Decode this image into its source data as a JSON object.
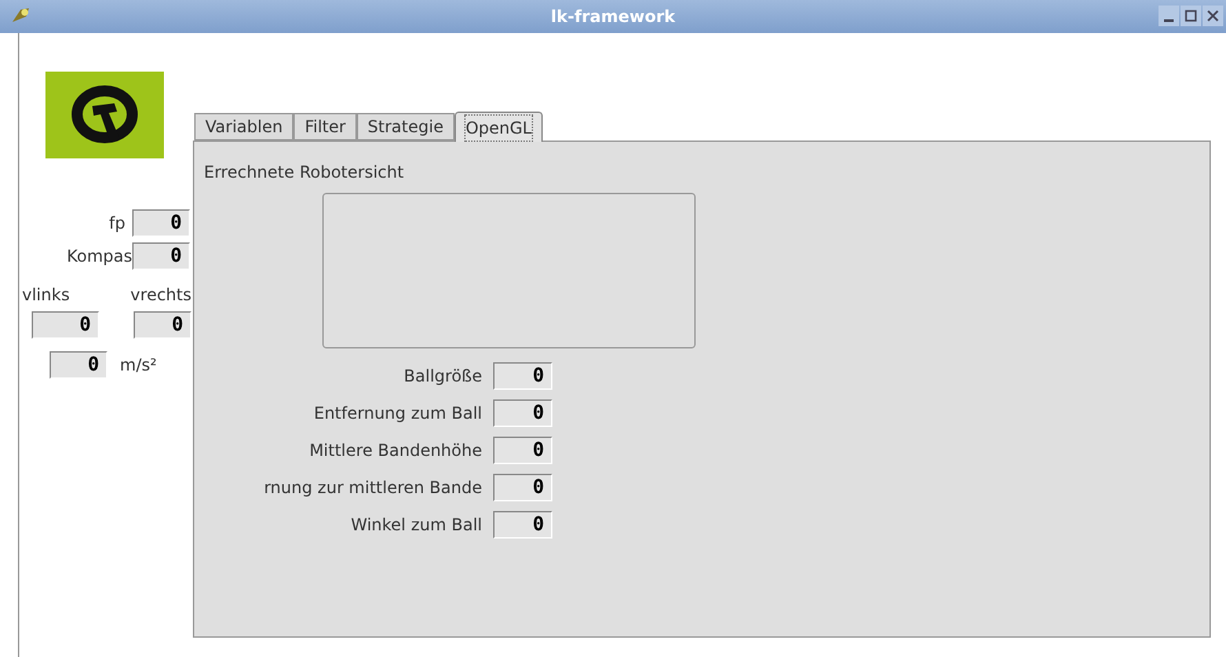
{
  "window": {
    "title": "lk-framework"
  },
  "sidebar": {
    "fps_label": "fp",
    "fps_value": "0",
    "compass_label": "Kompas",
    "compass_value": "0",
    "vleft_label": "vlinks",
    "vright_label": "vrechts",
    "vleft_value": "0",
    "vright_value": "0",
    "accel_value": "0",
    "accel_unit": "m/s²"
  },
  "tabs": [
    {
      "label": "Variablen",
      "selected": false
    },
    {
      "label": "Filter",
      "selected": false
    },
    {
      "label": "Strategie",
      "selected": false
    },
    {
      "label": "OpenGL",
      "selected": true
    }
  ],
  "panel": {
    "view_label": "Errechnete Robotersicht",
    "readouts": [
      {
        "label": "Ballgröße",
        "value": "0"
      },
      {
        "label": "Entfernung zum Ball",
        "value": "0"
      },
      {
        "label": "Mittlere Bandenhöhe",
        "value": "0"
      },
      {
        "label": "rnung zur mittleren Bande",
        "value": "0"
      },
      {
        "label": "Winkel zum Ball",
        "value": "0"
      }
    ]
  }
}
